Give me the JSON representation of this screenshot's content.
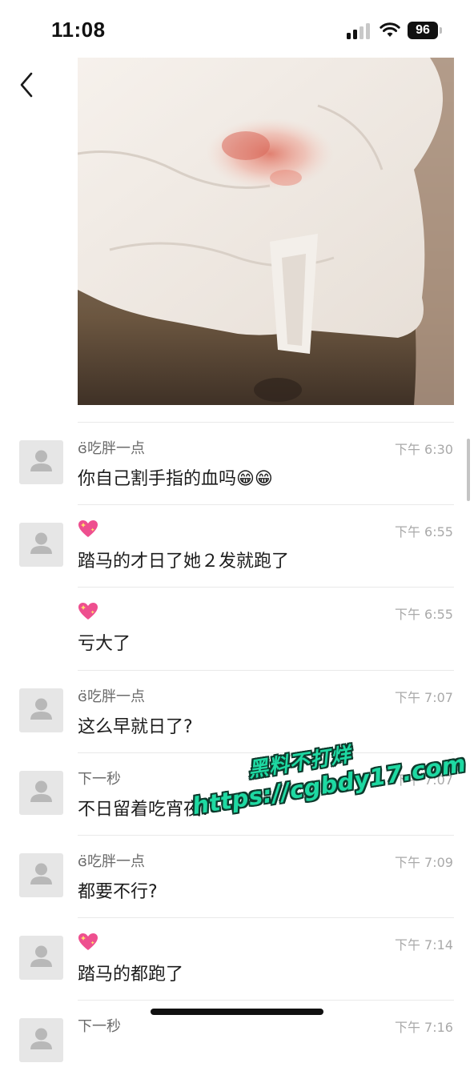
{
  "status_bar": {
    "time": "11:08",
    "battery": "96",
    "icons": [
      "signal-icon",
      "wifi-icon",
      "battery-icon"
    ]
  },
  "nav": {
    "back_icon": "chevron-left-icon",
    "more_icon": "more-horizontal-icon"
  },
  "comments": [
    {
      "name": "ɞ̈吃胖一点",
      "time": "下午 6:30",
      "text": "你自己割手指的血吗😁😁",
      "avatar": "default-avatar"
    },
    {
      "name": "",
      "name_icon": "sparkling-heart-icon",
      "time": "下午 6:55",
      "text": "踏马的才日了她２发就跑了",
      "avatar": "default-avatar"
    },
    {
      "name": "",
      "name_icon": "sparkling-heart-icon",
      "time": "下午 6:55",
      "text": "亏大了",
      "avatar": ""
    },
    {
      "name": "ɞ̈吃胖一点",
      "time": "下午 7:07",
      "text": "这么早就日了?",
      "avatar": "default-avatar"
    },
    {
      "name": "下一秒",
      "time": "下午 7:07",
      "text": "不日留着吃宵夜?",
      "avatar": "default-avatar"
    },
    {
      "name": "ɞ̈吃胖一点",
      "time": "下午 7:09",
      "text": "都要不行?",
      "avatar": "default-avatar"
    },
    {
      "name": "",
      "name_icon": "sparkling-heart-icon",
      "time": "下午 7:14",
      "text": "踏马的都跑了",
      "avatar": "default-avatar"
    },
    {
      "name": "下一秒",
      "time": "下午 7:16",
      "text": "",
      "avatar": "default-avatar"
    }
  ],
  "watermark": {
    "line1": "黑料不打烊",
    "line2": "https://cgbdy17.com"
  },
  "colors": {
    "watermark_fill": "#1ed9a2",
    "watermark_outline": "#0d3a2c",
    "timestamp": "#a9a9a9",
    "name": "#6b6b6b"
  }
}
